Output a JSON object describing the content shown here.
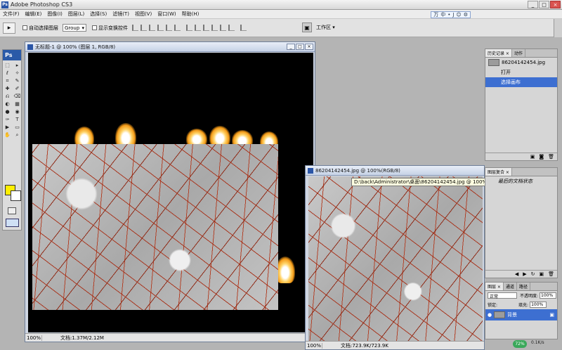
{
  "app": {
    "title": "Adobe Photoshop CS3",
    "badge": "Ps"
  },
  "window_controls": [
    "_",
    "□",
    "×"
  ],
  "menu": [
    "文件(F)",
    "编辑(E)",
    "图像(I)",
    "图层(L)",
    "选择(S)",
    "滤镜(T)",
    "视图(V)",
    "窗口(W)",
    "帮助(H)"
  ],
  "ime": [
    "万",
    "中",
    "•",
    "J",
    "☺",
    "⚙"
  ],
  "options": {
    "auto_select_label": "自动选择图层",
    "group_value": "Group",
    "show_transform_label": "显示变换控件",
    "workspace_label": "工作区 ▾",
    "bridge_icon": "bridge-icon"
  },
  "toolbox": {
    "logo": "Ps",
    "tools": [
      "⬚",
      "▸",
      "ℓ",
      "✧",
      "⌗",
      "✎",
      "✚",
      "✐",
      "⎌",
      "⌫",
      "◐",
      "▦",
      "●",
      "◉",
      "✑",
      "T",
      "▶",
      "▭",
      "✋",
      "⌕"
    ],
    "fg_color": "#ffee00",
    "bg_color": "#ffffff"
  },
  "doc1": {
    "title": "无标题-1 @ 100% (图层 1, RGB/8)",
    "zoom": "100%",
    "info": "文档:1.37M/2.12M"
  },
  "doc2": {
    "title": "86204142454.jpg @ 100%(RGB/8)",
    "zoom": "100%",
    "info": "文档:723.9K/723.9K",
    "tooltip": "D:\\back\\Administrator\\桌面\\86204142454.jpg @ 100%(RGB/8)"
  },
  "history": {
    "tabs": [
      "历史记录 ×",
      "动作"
    ],
    "snapshot": "86204142454.jpg",
    "items": [
      "打开",
      "选择画布"
    ],
    "selected_index": 1,
    "footer": [
      "▣",
      "◙",
      "🗑"
    ]
  },
  "layer_comps": {
    "tabs": [
      "图层复合 ×"
    ],
    "item": "最后的文档状态",
    "footer": [
      "◀",
      "▶",
      "↻",
      "▣",
      "🗑"
    ]
  },
  "layers": {
    "tabs": [
      "图层 ×",
      "通道",
      "路径"
    ],
    "blend_mode": "正常",
    "opacity_label": "不透明度:",
    "opacity": "100%",
    "lock_label": "锁定:",
    "fill_label": "填充:",
    "fill": "100%",
    "layer_name": "背景"
  },
  "tray": {
    "meter": "72%",
    "speed": "0.1K/s"
  },
  "colors": {
    "accent": "#3d6fd1",
    "titlebar": "#2a55a6",
    "crack_red": "#a8361f"
  }
}
